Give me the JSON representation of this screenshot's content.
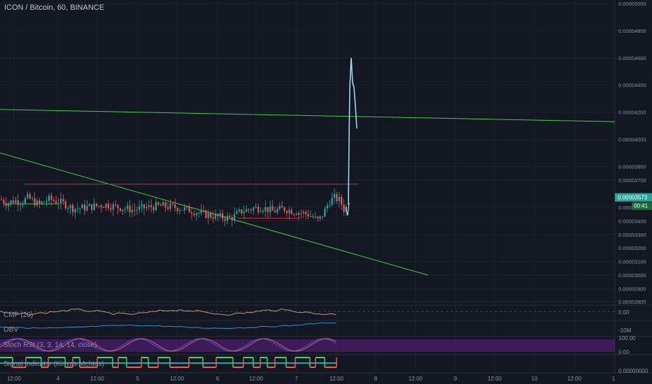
{
  "header": {
    "title": "ICON / Bitcoin, 60, BINANCE"
  },
  "price_axis": {
    "labels": [
      "0.00005000",
      "0.00004800",
      "0.00004600",
      "0.00004400",
      "0.00004200",
      "0.00004000",
      "0.00003800",
      "0.00003700",
      "0.00003500",
      "0.00003400",
      "0.00003300",
      "0.00003200",
      "0.00003100",
      "0.00003000",
      "0.00002900",
      "0.00002805"
    ],
    "last_price": "0.00003573",
    "countdown": "00:41",
    "last_price_color": "#26a69a"
  },
  "time_axis": {
    "labels": [
      "12:00",
      "4",
      "12:00",
      "5",
      "12:00",
      "6",
      "12:00",
      "7",
      "12:00",
      "8",
      "12:00",
      "9",
      "12:00",
      "10",
      "12:00",
      "1"
    ]
  },
  "indicators": [
    {
      "name": "CMF (20)",
      "axis": [
        "0.00"
      ]
    },
    {
      "name": "OBV",
      "axis": [
        "-10M"
      ]
    },
    {
      "name": "Stoch RSI (3, 3, 14, 14, close)",
      "axis": [
        "100.00",
        "0.00"
      ]
    },
    {
      "name": "Signal Indicator (Kirlyas Mehtas)",
      "axis": [
        "0.00000000"
      ]
    }
  ],
  "colors": {
    "background": "#131722",
    "up": "#26a69a",
    "down": "#ef5350",
    "trendline": "#3bd13b",
    "resistance": "#d32f2f",
    "spike": "#9fd7ea",
    "cmf": "#c49a6c",
    "obv": "#2a8fdb",
    "stoch_k": "#2962ff",
    "stoch_d": "#ff5252",
    "stoch_band": "#4a1f6b",
    "signal_up": "#3bd16f",
    "signal_down": "#ff5252"
  },
  "chart_data": {
    "type": "candlestick",
    "title": "ICON / Bitcoin, 60, BINANCE",
    "ylim": [
      2.79e-05,
      5e-05
    ],
    "last_price": 3.573e-05,
    "x_ticks": [
      "12:00",
      "4",
      "12:00",
      "5",
      "12:00",
      "6",
      "12:00",
      "7",
      "12:00",
      "8",
      "12:00",
      "9",
      "12:00",
      "10",
      "12:00",
      "1"
    ],
    "price_path": [
      [
        0,
        3.56e-05
      ],
      [
        10,
        3.53e-05
      ],
      [
        20,
        3.55e-05
      ],
      [
        30,
        3.54e-05
      ],
      [
        40,
        3.57e-05
      ],
      [
        55,
        3.52e-05
      ],
      [
        70,
        3.56e-05
      ],
      [
        90,
        3.53e-05
      ],
      [
        105,
        3.49e-05
      ],
      [
        125,
        3.5e-05
      ],
      [
        150,
        3.52e-05
      ],
      [
        170,
        3.5e-05
      ],
      [
        190,
        3.48e-05
      ],
      [
        210,
        3.5e-05
      ],
      [
        230,
        3.51e-05
      ],
      [
        250,
        3.5e-05
      ],
      [
        270,
        3.48e-05
      ],
      [
        290,
        3.45e-05
      ],
      [
        310,
        3.43e-05
      ],
      [
        330,
        3.42e-05
      ],
      [
        345,
        3.47e-05
      ],
      [
        360,
        3.49e-05
      ],
      [
        375,
        3.5e-05
      ],
      [
        390,
        3.47e-05
      ],
      [
        405,
        3.49e-05
      ],
      [
        420,
        3.47e-05
      ],
      [
        440,
        3.45e-05
      ],
      [
        455,
        3.4e-05
      ],
      [
        462,
        3.45e-05
      ],
      [
        470,
        3.54e-05
      ],
      [
        478,
        3.57e-05
      ],
      [
        486,
        3.55e-05
      ],
      [
        492,
        3.48e-05
      ],
      [
        498,
        3.52e-05
      ]
    ],
    "spike": [
      [
        498,
        3.52e-05
      ],
      [
        499,
        4e-05
      ],
      [
        500,
        4.38e-05
      ],
      [
        502,
        4.6e-05
      ],
      [
        504,
        4.42e-05
      ],
      [
        506,
        4.38e-05
      ],
      [
        508,
        4.25e-05
      ],
      [
        510,
        4.08e-05
      ]
    ],
    "trendlines": [
      {
        "from": [
          0,
          4.22e-05
        ],
        "to": [
          879,
          4.13e-05
        ],
        "color": "green"
      },
      {
        "from": [
          0,
          3.9e-05
        ],
        "to": [
          612,
          3e-05
        ],
        "color": "green"
      }
    ],
    "resistance": [
      {
        "from": [
          35,
          3.67e-05
        ],
        "to": [
          512,
          3.67e-05
        ]
      },
      {
        "from": [
          340,
          3.42e-05
        ],
        "to": [
          428,
          3.42e-05
        ]
      }
    ]
  }
}
